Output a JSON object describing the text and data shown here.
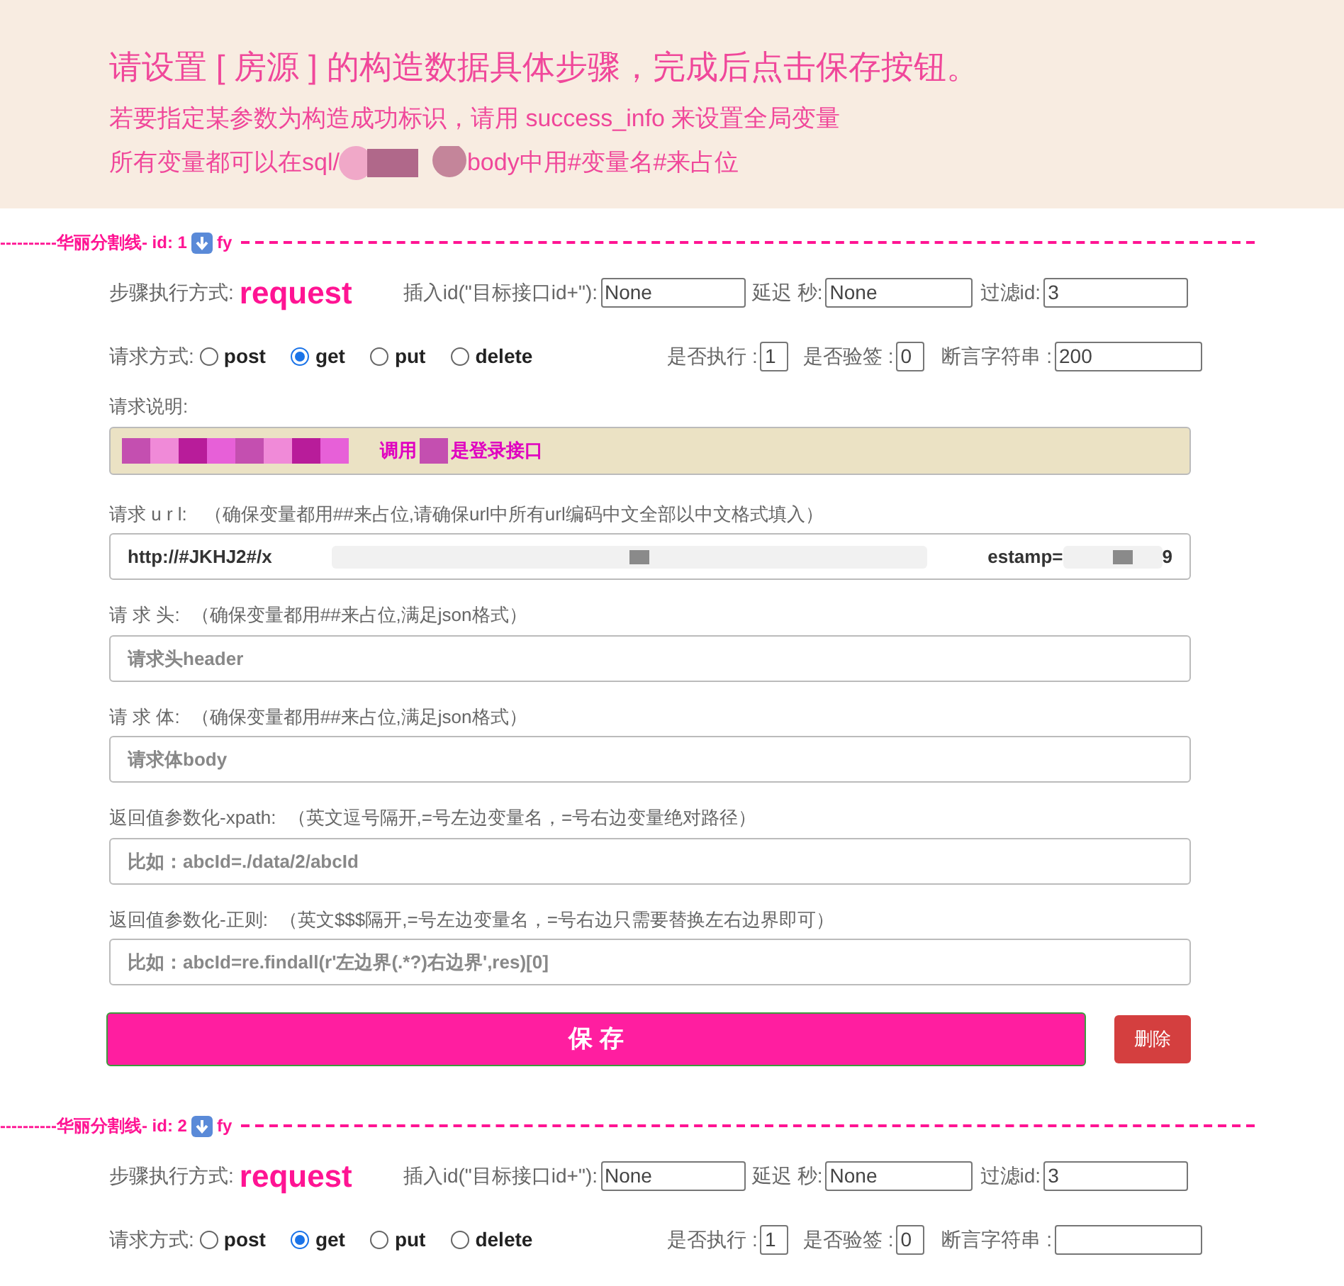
{
  "notice": {
    "title": "请设置 [ 房源 ] 的构造数据具体步骤，完成后点击保存按钮。",
    "line_1": "若要指定某参数为构造成功标识，请用 success_info 来设置全局变量",
    "line_2_parts": [
      "所有变量都可以在sql/",
      "body中用#变量名#来占位"
    ]
  },
  "steps": [
    {
      "divider": {
        "label": "----------华丽分割线- id: 1",
        "suffix": "fy"
      },
      "mode_label": "步骤执行方式:",
      "mode": "request",
      "insert_label": "插入id(\"目标接口id+\"):",
      "insert_value": "None",
      "delay_label": "延迟 秒:",
      "delay_value": "None",
      "filter_label": "过滤id:",
      "filter_value": "3",
      "method_label": "请求方式:",
      "methods": [
        {
          "label": "post",
          "selected": false
        },
        {
          "label": "get",
          "selected": true
        },
        {
          "label": "put",
          "selected": false
        },
        {
          "label": "delete",
          "selected": false
        }
      ],
      "execute_label": "是否执行 :",
      "execute_value": "1",
      "verify_label": "是否验签 :",
      "verify_value": "0",
      "assert_label": "断言字符串 :",
      "assert_value": "200",
      "details": {
        "desc_label": "请求说明:",
        "desc_parts": [
          "调用",
          "是登录接口"
        ],
        "url_label": "请求 u r l:",
        "url_hint": "（确保变量都用##来占位,请确保url中所有url编码中文全部以中文格式填入）",
        "url_parts": [
          "http://#JKHJ2#/x",
          "estamp=",
          "9"
        ],
        "fields": [
          {
            "label": "请 求 头:",
            "hint": "（确保变量都用##来占位,满足json格式）",
            "placeholder": "请求头header"
          },
          {
            "label": "请 求 体:",
            "hint": "（确保变量都用##来占位,满足json格式）",
            "placeholder": "请求体body"
          },
          {
            "label": "返回值参数化-xpath:",
            "hint": "（英文逗号隔开,=号左边变量名，=号右边变量绝对路径）",
            "placeholder": "比如：abcId=./data/2/abcId"
          },
          {
            "label": "返回值参数化-正则:",
            "hint": "（英文$$$隔开,=号左边变量名，=号右边只需要替换左右边界即可）",
            "placeholder": "比如：abcId=re.findall(r'左边界(.*?)右边界',res)[0]"
          }
        ],
        "save": "保 存",
        "delete": "删除"
      }
    },
    {
      "divider": {
        "label": "----------华丽分割线- id: 2",
        "suffix": "fy"
      },
      "mode_label": "步骤执行方式:",
      "mode": "request",
      "insert_label": "插入id(\"目标接口id+\"):",
      "insert_value": "None",
      "delay_label": "延迟 秒:",
      "delay_value": "None",
      "filter_label": "过滤id:",
      "filter_value": "3",
      "method_label": "请求方式:",
      "methods": [
        {
          "label": "post",
          "selected": false
        },
        {
          "label": "get",
          "selected": true
        },
        {
          "label": "put",
          "selected": false
        },
        {
          "label": "delete",
          "selected": false
        }
      ],
      "execute_label": "是否执行 :",
      "execute_value": "1",
      "verify_label": "是否验签 :",
      "verify_value": "0",
      "assert_label": "断言字符串 :"
    }
  ]
}
